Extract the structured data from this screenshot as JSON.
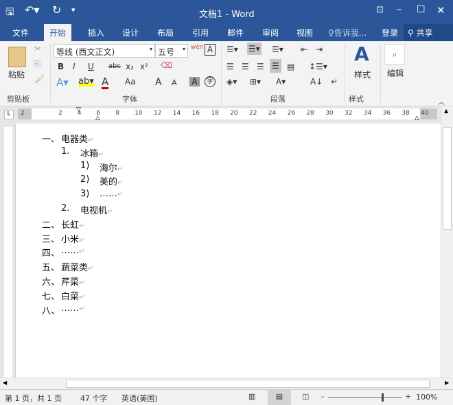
{
  "title": "文档1 - Word",
  "qat": {
    "save": "save-icon",
    "undo": "undo-icon",
    "redo": "redo-icon"
  },
  "tabs": [
    "文件",
    "开始",
    "插入",
    "设计",
    "布局",
    "引用",
    "邮件",
    "审阅",
    "视图"
  ],
  "tell_me": "告诉我...",
  "login": "登录",
  "share": "共享",
  "ribbon": {
    "paste": "粘贴",
    "font_name": "等线 (西文正文)",
    "font_size": "五号",
    "styles": "样式",
    "editing": "编辑",
    "groups": [
      "剪贴板",
      "字体",
      "段落",
      "样式"
    ],
    "bold": "B",
    "italic": "I",
    "underline": "U",
    "strike": "abc",
    "sub": "x₂",
    "sup": "x²",
    "case": "Aa",
    "grow": "A",
    "shrink": "A",
    "wen": "wén"
  },
  "ruler": [
    "2",
    "2",
    "4",
    "6",
    "8",
    "10",
    "12",
    "14",
    "16",
    "18",
    "20",
    "22",
    "24",
    "26",
    "28",
    "30",
    "32",
    "34",
    "36",
    "38",
    "40"
  ],
  "document": [
    {
      "num": "一、",
      "text": "电器类",
      "level": 1
    },
    {
      "num": "1.",
      "text": "冰箱",
      "level": 2
    },
    {
      "num": "1)",
      "text": "海尔",
      "level": 3
    },
    {
      "num": "2)",
      "text": "美的",
      "level": 3
    },
    {
      "num": "3)",
      "text": "……",
      "level": 3
    },
    {
      "num": "2.",
      "text": "电视机",
      "level": 2
    },
    {
      "num": "二、",
      "text": "长虹",
      "level": 1
    },
    {
      "num": "三、",
      "text": "小米",
      "level": 1
    },
    {
      "num": "四、",
      "text": "……",
      "level": 1
    },
    {
      "num": "五、",
      "text": "蔬菜类",
      "level": 1
    },
    {
      "num": "六、",
      "text": "芹菜",
      "level": 1
    },
    {
      "num": "七、",
      "text": "白菜",
      "level": 1
    },
    {
      "num": "八、",
      "text": "……",
      "level": 1
    }
  ],
  "status": {
    "page": "第 1 页，共 1 页",
    "words": "47 个字",
    "lang": "英语(美国)",
    "zoom": "100%",
    "zoom_pct": 100
  },
  "colors": {
    "brand": "#2b579a",
    "highlight": "#ffff00",
    "font_color": "#c00000"
  }
}
